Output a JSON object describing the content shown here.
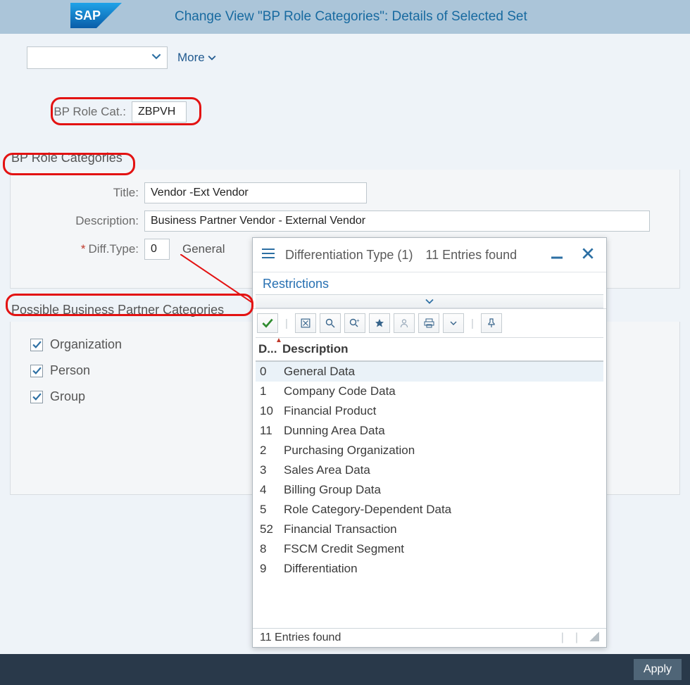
{
  "header": {
    "page_title": "Change View \"BP Role Categories\": Details of Selected Set",
    "more_label": "More"
  },
  "fields": {
    "bp_role_cat_label": "BP Role Cat.:",
    "bp_role_cat_value": "ZBPVH",
    "title_label": "Title:",
    "title_value": "Vendor -Ext Vendor",
    "description_label": "Description:",
    "description_value": "Business Partner Vendor - External Vendor",
    "diff_type_label": "Diff.Type:",
    "diff_type_value": "0",
    "diff_type_text": "General"
  },
  "sections": {
    "role_categories": "BP Role Categories",
    "possible_categories": "Possible Business Partner Categories"
  },
  "checkboxes": {
    "organization": "Organization",
    "person": "Person",
    "group": "Group"
  },
  "popup": {
    "title": "Differentiation Type (1)",
    "count_text": "11 Entries found",
    "restrictions": "Restrictions",
    "col_d": "D...",
    "col_desc": "Description",
    "rows": [
      {
        "d": "0",
        "desc": "General Data",
        "selected": true
      },
      {
        "d": "1",
        "desc": "Company Code Data"
      },
      {
        "d": "10",
        "desc": "Financial Product"
      },
      {
        "d": "11",
        "desc": "Dunning Area Data"
      },
      {
        "d": "2",
        "desc": "Purchasing Organization"
      },
      {
        "d": "3",
        "desc": "Sales Area Data"
      },
      {
        "d": "4",
        "desc": "Billing Group Data"
      },
      {
        "d": "5",
        "desc": "Role Category-Dependent Data"
      },
      {
        "d": "52",
        "desc": "Financial Transaction"
      },
      {
        "d": "8",
        "desc": "FSCM Credit Segment"
      },
      {
        "d": "9",
        "desc": "Differentiation"
      }
    ],
    "footer_text": "11 Entries found"
  },
  "footer": {
    "apply": "Apply"
  }
}
